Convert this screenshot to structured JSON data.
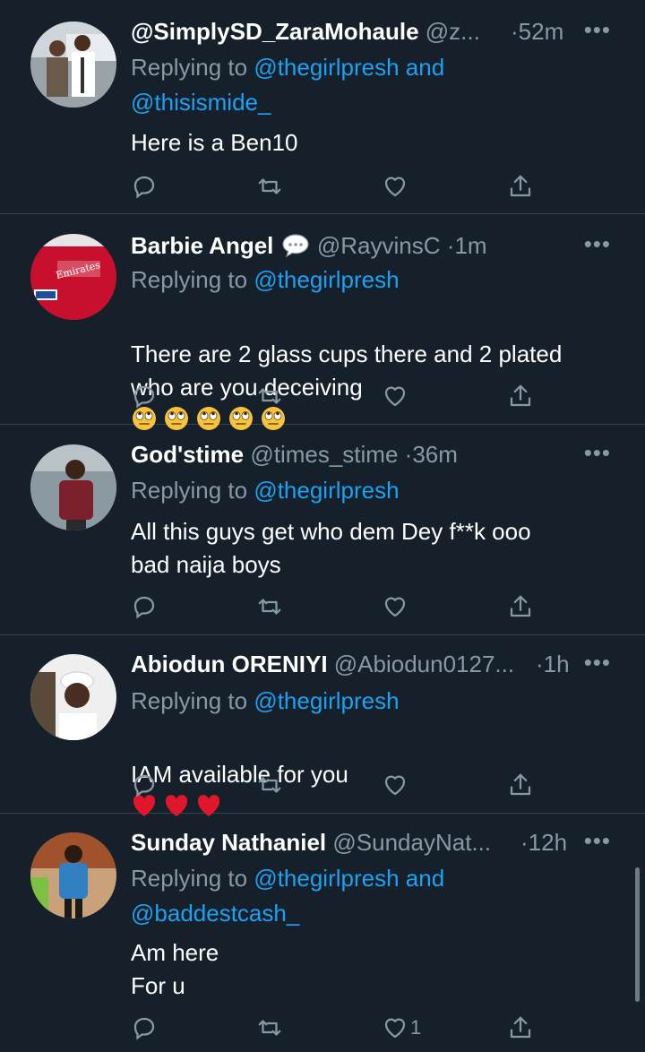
{
  "tweets": [
    {
      "name": "@SimplySD_ZaraMohaule",
      "handle": "@z...",
      "time": "52m",
      "replying_prefix": "Replying to ",
      "replying_to": [
        "@thegirlpresh",
        "and",
        "@thisismide_"
      ],
      "text": "Here is a Ben10",
      "like_count": ""
    },
    {
      "name": "Barbie Angel",
      "handle": "@RayvinsC",
      "time": "1m",
      "replying_prefix": "Replying to ",
      "replying_to": [
        "@thegirlpresh"
      ],
      "text": "There are 2 glass cups there and 2 plated who are you deceiving",
      "emoji": "face-with-rolling-eyes",
      "emoji_count": 5,
      "like_count": ""
    },
    {
      "name": "God'stime",
      "handle": "@times_stime",
      "time": "36m",
      "replying_prefix": "Replying to ",
      "replying_to": [
        "@thegirlpresh"
      ],
      "text": "All this guys get who dem Dey f**k ooo\nbad naija boys",
      "like_count": ""
    },
    {
      "name": "Abiodun ORENIYI",
      "handle": "@Abiodun0127...",
      "time": "1h",
      "replying_prefix": "Replying to ",
      "replying_to": [
        "@thegirlpresh"
      ],
      "text": "IAM available for you",
      "emoji": "red-heart",
      "emoji_count": 3,
      "like_count": ""
    },
    {
      "name": "Sunday Nathaniel",
      "handle": "@SundayNat...",
      "time": "12h",
      "replying_prefix": "Replying to ",
      "replying_to": [
        "@thegirlpresh",
        "and",
        "@baddestcash_"
      ],
      "text": "Am here\nFor u",
      "like_count": "1"
    }
  ],
  "colors": {
    "background": "#15202b",
    "divider": "#38444d",
    "secondary_text": "#8899a6",
    "link": "#1da1f2"
  },
  "icons": [
    "reply-icon",
    "retweet-icon",
    "like-icon",
    "share-icon",
    "more-icon",
    "speech-bubble-icon"
  ]
}
